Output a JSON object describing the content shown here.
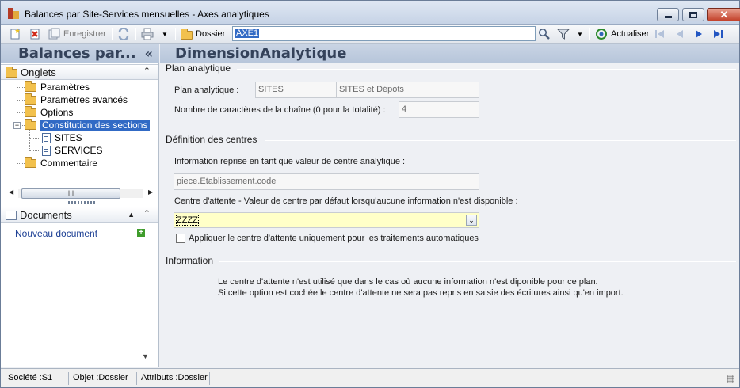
{
  "window": {
    "title": "Balances par Site-Services mensuelles -  Axes analytiques"
  },
  "toolbar": {
    "save_label": "Enregistrer",
    "folder_label": "Dossier",
    "search_value": "AXE1",
    "refresh_label": "Actualiser"
  },
  "left_panel": {
    "header": "Balances par...",
    "collapse_glyph": "«",
    "tabs_section": "Onglets",
    "tree": [
      {
        "label": "Paramètres",
        "type": "folder"
      },
      {
        "label": "Paramètres avancés",
        "type": "folder"
      },
      {
        "label": "Options",
        "type": "folder"
      },
      {
        "label": "Constitution des sections",
        "type": "folder-open",
        "selected": true
      },
      {
        "label": "SITES",
        "type": "doc"
      },
      {
        "label": "SERVICES",
        "type": "doc"
      },
      {
        "label": "Commentaire",
        "type": "folder"
      }
    ],
    "scroll_thumb_glyph": "III",
    "documents_section": "Documents",
    "new_document": "Nouveau document"
  },
  "main": {
    "header": "DimensionAnalytique",
    "plan_group": "Plan analytique",
    "plan_label": "Plan analytique :",
    "plan_code": "SITES",
    "plan_name": "SITES et Dépots",
    "chars_label": "Nombre de caractères de la chaîne (0 pour la totalité) :",
    "chars_value": "4",
    "centres_group": "Définition des centres",
    "info_reprise_label": "Information reprise en tant que valeur de centre analytique :",
    "info_reprise_value": "piece.Etablissement.code",
    "attente_label": "Centre d'attente - Valeur de centre par défaut lorsqu'aucune information n'est disponible :",
    "attente_value": "ZZZZ",
    "checkbox_label": "Appliquer le centre d'attente uniquement pour les traitements automatiques",
    "checkbox_checked": false,
    "info_group": "Information",
    "info_line1": "Le centre d'attente n'est utilisé que dans le cas où aucune information n'est diponible pour ce plan.",
    "info_line2": "Si cette option est cochée le centre d'attente ne sera pas repris en saisie des écritures ainsi qu'en import."
  },
  "statusbar": {
    "societe": "Société :S1",
    "objet": "Objet :Dossier",
    "attributs": "Attributs :Dossier"
  },
  "colors": {
    "selection": "#316ac5",
    "header_bg": "#b6c5da",
    "yellow_field": "#ffffc8"
  }
}
